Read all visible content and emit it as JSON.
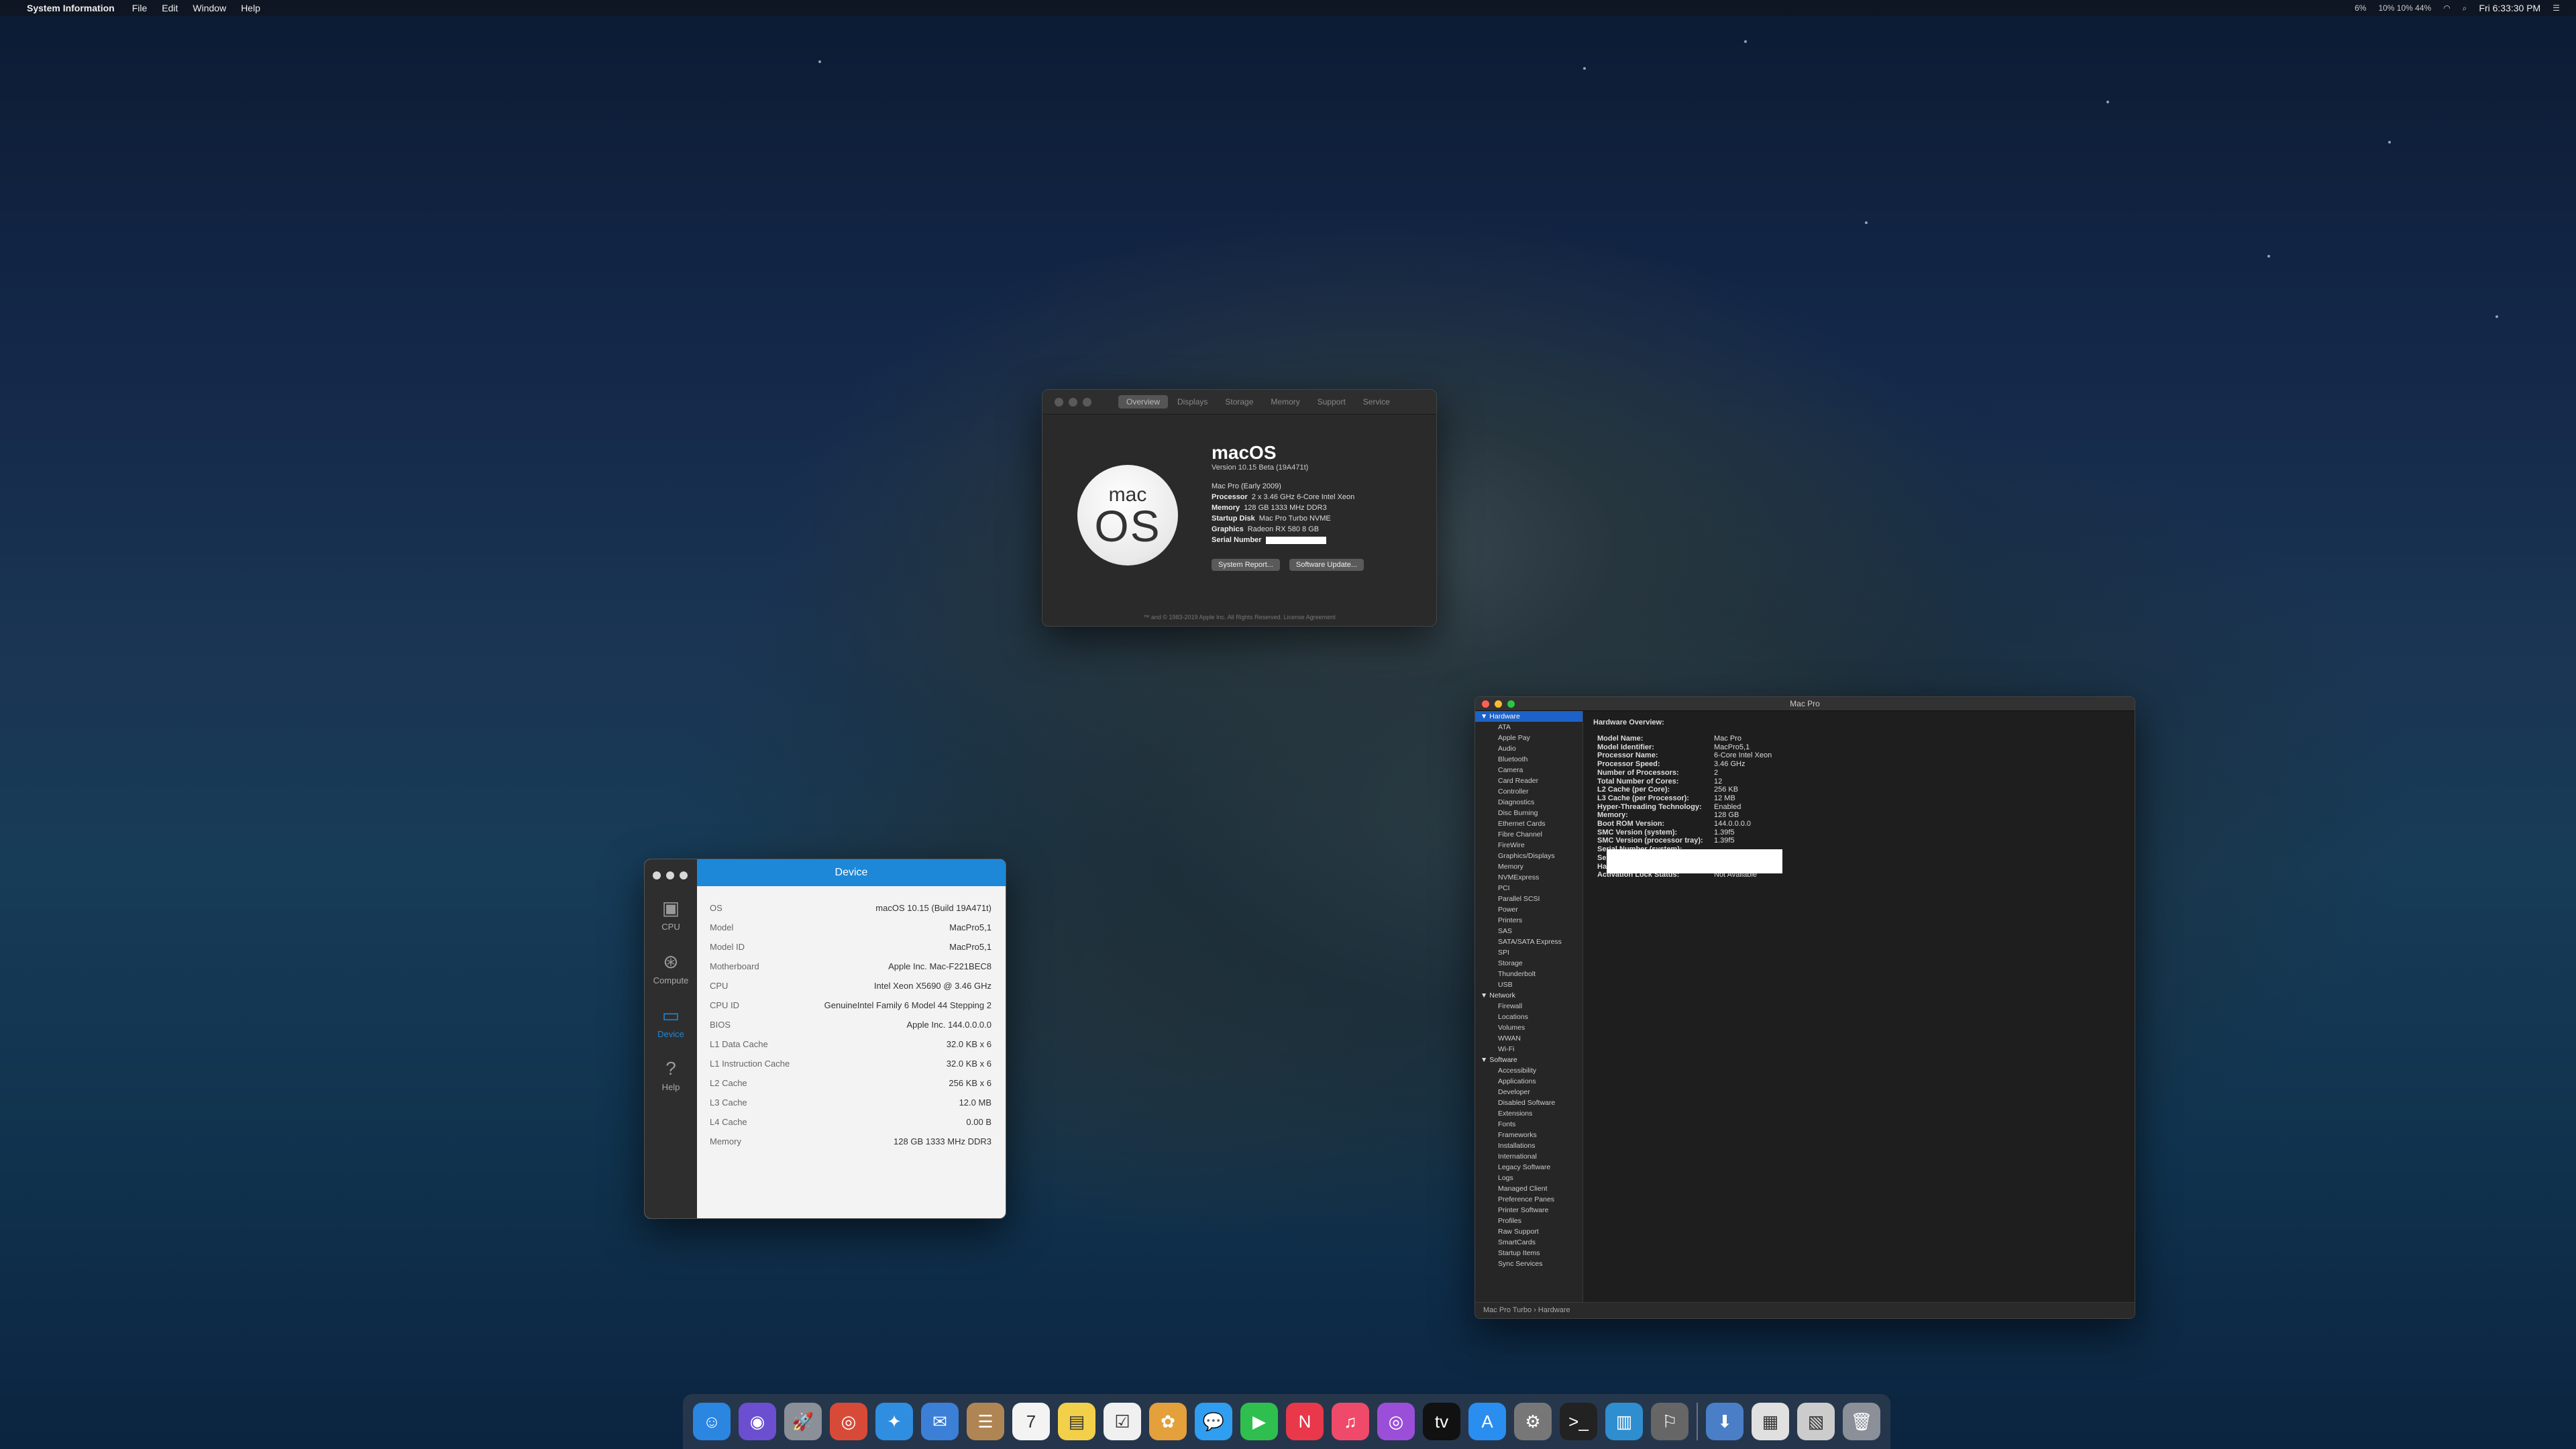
{
  "menubar": {
    "app": "System Information",
    "items": [
      "File",
      "Edit",
      "Window",
      "Help"
    ],
    "battery_pct": "6%",
    "cpu_stats": "10% 10% 44%",
    "clock": "Fri 6:33:30 PM"
  },
  "about": {
    "tabs": [
      "Overview",
      "Displays",
      "Storage",
      "Memory",
      "Support",
      "Service"
    ],
    "logo_line1": "mac",
    "logo_line2": "OS",
    "title": "macOS",
    "version": "Version 10.15 Beta (19A471t)",
    "model": "Mac Pro (Early 2009)",
    "rows": [
      {
        "label": "Processor",
        "value": "2 x 3.46 GHz 6-Core Intel Xeon"
      },
      {
        "label": "Memory",
        "value": "128 GB 1333 MHz DDR3"
      },
      {
        "label": "Startup Disk",
        "value": "Mac Pro Turbo NVME"
      },
      {
        "label": "Graphics",
        "value": "Radeon RX 580 8 GB"
      }
    ],
    "serial_label": "Serial Number",
    "btn_report": "System Report...",
    "btn_update": "Software Update...",
    "footer": "™ and © 1983-2019 Apple Inc. All Rights Reserved. License Agreement"
  },
  "device": {
    "header": "Device",
    "nav": [
      {
        "label": "CPU",
        "icon": "cpu-icon"
      },
      {
        "label": "Compute",
        "icon": "compute-icon"
      },
      {
        "label": "Device",
        "icon": "device-icon"
      },
      {
        "label": "Help",
        "icon": "help-icon"
      }
    ],
    "rows": [
      {
        "k": "OS",
        "v": "macOS 10.15 (Build 19A471t)"
      },
      {
        "k": "Model",
        "v": "MacPro5,1"
      },
      {
        "k": "Model ID",
        "v": "MacPro5,1"
      },
      {
        "k": "Motherboard",
        "v": "Apple Inc. Mac-F221BEC8"
      },
      {
        "k": "CPU",
        "v": "Intel Xeon X5690 @ 3.46 GHz"
      },
      {
        "k": "CPU ID",
        "v": "GenuineIntel Family 6 Model 44 Stepping 2"
      },
      {
        "k": "BIOS",
        "v": "Apple Inc. 144.0.0.0.0"
      },
      {
        "k": "L1 Data Cache",
        "v": "32.0 KB x 6"
      },
      {
        "k": "L1 Instruction Cache",
        "v": "32.0 KB x 6"
      },
      {
        "k": "L2 Cache",
        "v": "256 KB x 6"
      },
      {
        "k": "L3 Cache",
        "v": "12.0 MB"
      },
      {
        "k": "L4 Cache",
        "v": "0.00 B"
      },
      {
        "k": "Memory",
        "v": "128 GB 1333 MHz DDR3"
      }
    ]
  },
  "macpro": {
    "title": "Mac Pro",
    "tree": [
      {
        "t": "▼ Hardware",
        "g": true,
        "sel": true
      },
      {
        "t": "ATA"
      },
      {
        "t": "Apple Pay"
      },
      {
        "t": "Audio"
      },
      {
        "t": "Bluetooth"
      },
      {
        "t": "Camera"
      },
      {
        "t": "Card Reader"
      },
      {
        "t": "Controller"
      },
      {
        "t": "Diagnostics"
      },
      {
        "t": "Disc Burning"
      },
      {
        "t": "Ethernet Cards"
      },
      {
        "t": "Fibre Channel"
      },
      {
        "t": "FireWire"
      },
      {
        "t": "Graphics/Displays"
      },
      {
        "t": "Memory"
      },
      {
        "t": "NVMExpress"
      },
      {
        "t": "PCI"
      },
      {
        "t": "Parallel SCSI"
      },
      {
        "t": "Power"
      },
      {
        "t": "Printers"
      },
      {
        "t": "SAS"
      },
      {
        "t": "SATA/SATA Express"
      },
      {
        "t": "SPI"
      },
      {
        "t": "Storage"
      },
      {
        "t": "Thunderbolt"
      },
      {
        "t": "USB"
      },
      {
        "t": "▼ Network",
        "g": true
      },
      {
        "t": "Firewall"
      },
      {
        "t": "Locations"
      },
      {
        "t": "Volumes"
      },
      {
        "t": "WWAN"
      },
      {
        "t": "Wi-Fi"
      },
      {
        "t": "▼ Software",
        "g": true
      },
      {
        "t": "Accessibility"
      },
      {
        "t": "Applications"
      },
      {
        "t": "Developer"
      },
      {
        "t": "Disabled Software"
      },
      {
        "t": "Extensions"
      },
      {
        "t": "Fonts"
      },
      {
        "t": "Frameworks"
      },
      {
        "t": "Installations"
      },
      {
        "t": "International"
      },
      {
        "t": "Legacy Software"
      },
      {
        "t": "Logs"
      },
      {
        "t": "Managed Client"
      },
      {
        "t": "Preference Panes"
      },
      {
        "t": "Printer Software"
      },
      {
        "t": "Profiles"
      },
      {
        "t": "Raw Support"
      },
      {
        "t": "SmartCards"
      },
      {
        "t": "Startup Items"
      },
      {
        "t": "Sync Services"
      }
    ],
    "detail_title": "Hardware Overview:",
    "detail": [
      {
        "k": "Model Name:",
        "v": "Mac Pro"
      },
      {
        "k": "Model Identifier:",
        "v": "MacPro5,1"
      },
      {
        "k": "Processor Name:",
        "v": "6-Core Intel Xeon"
      },
      {
        "k": "Processor Speed:",
        "v": "3.46 GHz"
      },
      {
        "k": "Number of Processors:",
        "v": "2"
      },
      {
        "k": "Total Number of Cores:",
        "v": "12"
      },
      {
        "k": "L2 Cache (per Core):",
        "v": "256 KB"
      },
      {
        "k": "L3 Cache (per Processor):",
        "v": "12 MB"
      },
      {
        "k": "Hyper-Threading Technology:",
        "v": "Enabled"
      },
      {
        "k": "Memory:",
        "v": "128 GB"
      },
      {
        "k": "Boot ROM Version:",
        "v": "144.0.0.0.0"
      },
      {
        "k": "SMC Version (system):",
        "v": "1.39f5"
      },
      {
        "k": "SMC Version (processor tray):",
        "v": "1.39f5"
      },
      {
        "k": "Serial Number (system):",
        "v": ""
      },
      {
        "k": "Serial Number (processor tray):",
        "v": ""
      },
      {
        "k": "Hardware UUID:",
        "v": ""
      },
      {
        "k": "Activation Lock Status:",
        "v": "Not Available"
      }
    ],
    "status": "Mac Pro Turbo › Hardware"
  },
  "dock": [
    {
      "name": "finder-icon",
      "glyph": "☺",
      "color": "#2a86e0"
    },
    {
      "name": "siri-icon",
      "glyph": "◉",
      "color": "#6b4fd0"
    },
    {
      "name": "launchpad-icon",
      "glyph": "🚀",
      "color": "#8a8f98"
    },
    {
      "name": "chrome-icon",
      "glyph": "◎",
      "color": "#d84a38"
    },
    {
      "name": "safari-icon",
      "glyph": "✦",
      "color": "#2f8ee0"
    },
    {
      "name": "mail-icon",
      "glyph": "✉",
      "color": "#3c7fd6"
    },
    {
      "name": "contacts-icon",
      "glyph": "☰",
      "color": "#b08554"
    },
    {
      "name": "calendar-icon",
      "glyph": "7",
      "color": "#f3f3f3"
    },
    {
      "name": "notes-icon",
      "glyph": "▤",
      "color": "#f2d04a"
    },
    {
      "name": "reminders-icon",
      "glyph": "☑",
      "color": "#f0f0f0"
    },
    {
      "name": "photos-icon",
      "glyph": "✿",
      "color": "#e4a03a"
    },
    {
      "name": "messages-icon",
      "glyph": "💬",
      "color": "#2f9ef0"
    },
    {
      "name": "facetime-icon",
      "glyph": "▶",
      "color": "#2fbf4f"
    },
    {
      "name": "news-icon",
      "glyph": "N",
      "color": "#e8384a"
    },
    {
      "name": "music-icon",
      "glyph": "♫",
      "color": "#f04a6a"
    },
    {
      "name": "podcasts-icon",
      "glyph": "◎",
      "color": "#9b4fd8"
    },
    {
      "name": "tv-icon",
      "glyph": "tv",
      "color": "#111111"
    },
    {
      "name": "app-store-icon",
      "glyph": "A",
      "color": "#2a8ef0"
    },
    {
      "name": "system-preferences-icon",
      "glyph": "⚙",
      "color": "#777777"
    },
    {
      "name": "terminal-icon",
      "glyph": ">_",
      "color": "#222222"
    },
    {
      "name": "activity-monitor-icon",
      "glyph": "▥",
      "color": "#2f8ed0"
    },
    {
      "name": "automator-icon",
      "glyph": "⚐",
      "color": "#666666"
    },
    {
      "name": "downloads-icon",
      "glyph": "⬇",
      "color": "#4a7fc8"
    },
    {
      "name": "documents-icon",
      "glyph": "▦",
      "color": "#e0e0e0"
    },
    {
      "name": "screenshots-icon",
      "glyph": "▧",
      "color": "#cccccc"
    },
    {
      "name": "trash-icon",
      "glyph": "🗑",
      "color": "#8a8f98"
    }
  ]
}
